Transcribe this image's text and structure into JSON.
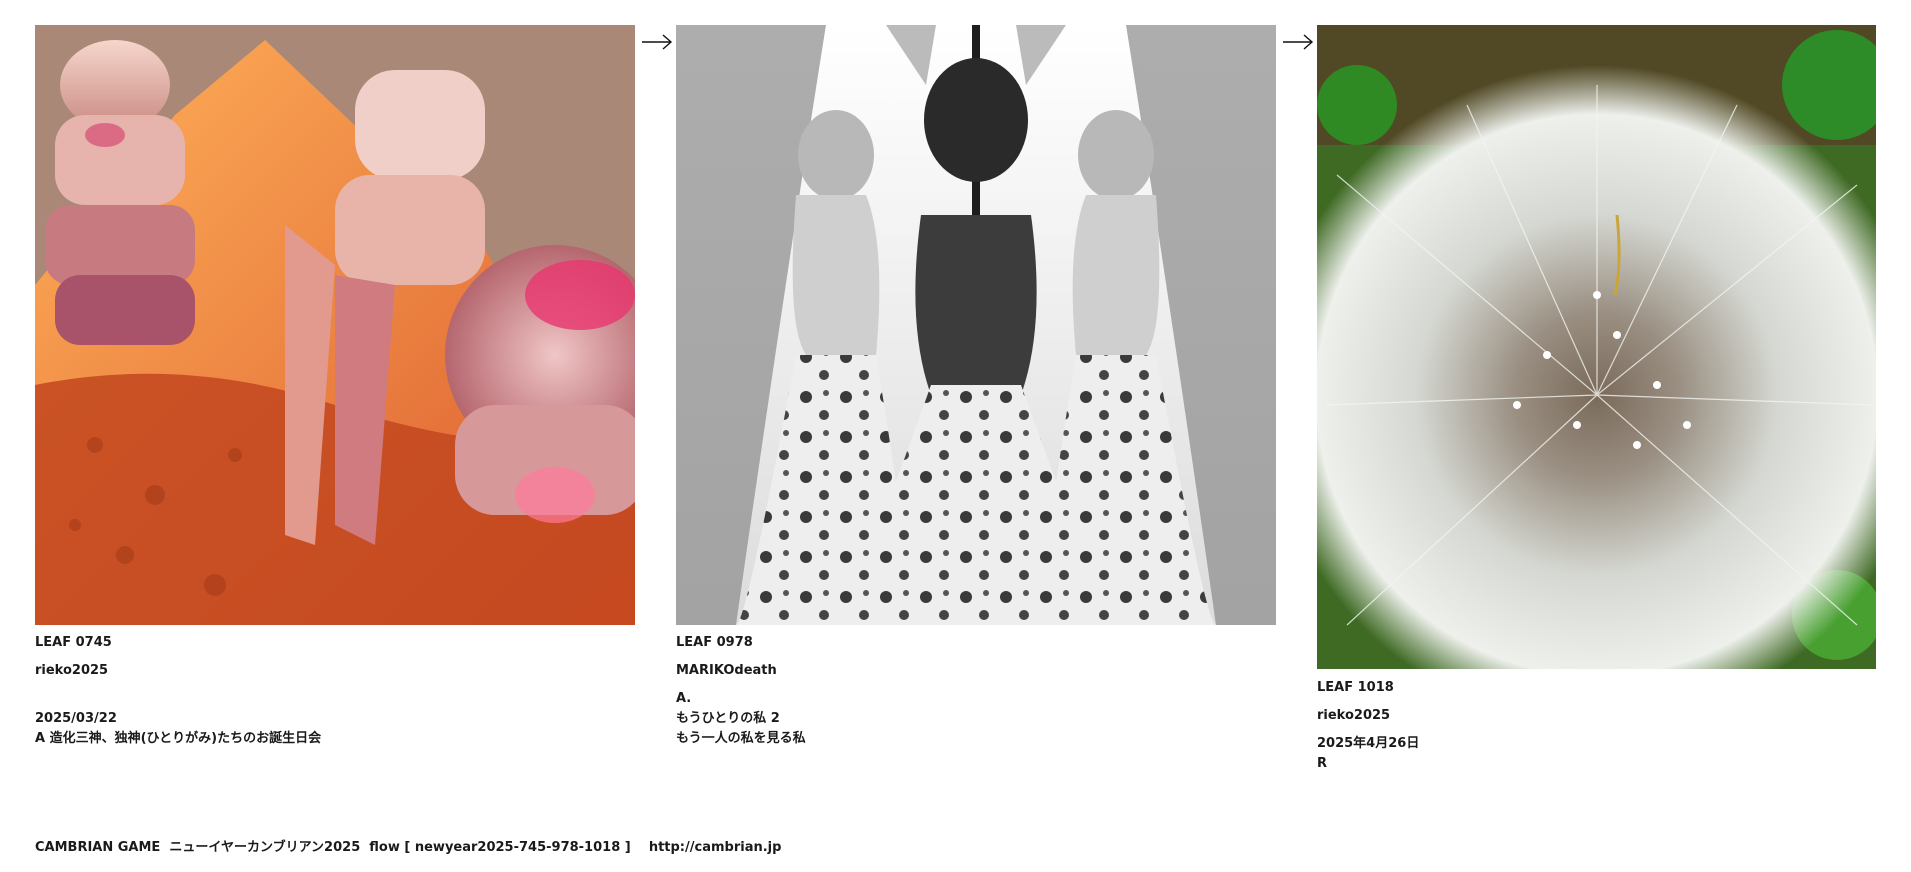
{
  "cards": [
    {
      "leaf": "LEAF 0745",
      "author": "rieko2025",
      "line1": "2025/03/22",
      "line2": "A 造化三神、独神(ひとりがみ)たちのお誕生日会"
    },
    {
      "leaf": "LEAF 0978",
      "author": "MARIKOdeath",
      "line1": "A.",
      "line2": "もうひとりの私 2",
      "line3": "もう一人の私を見る私"
    },
    {
      "leaf": "LEAF 1018",
      "author": "rieko2025",
      "line1": "2025年4月26日",
      "line2": "R"
    }
  ],
  "footer": {
    "text": "CAMBRIAN GAME  ニューイヤーカンブリアン2025  flow [ newyear2025-745-978-1018 ]    http://cambrian.jp"
  },
  "icons": {
    "arrow": "right-arrow-icon"
  }
}
